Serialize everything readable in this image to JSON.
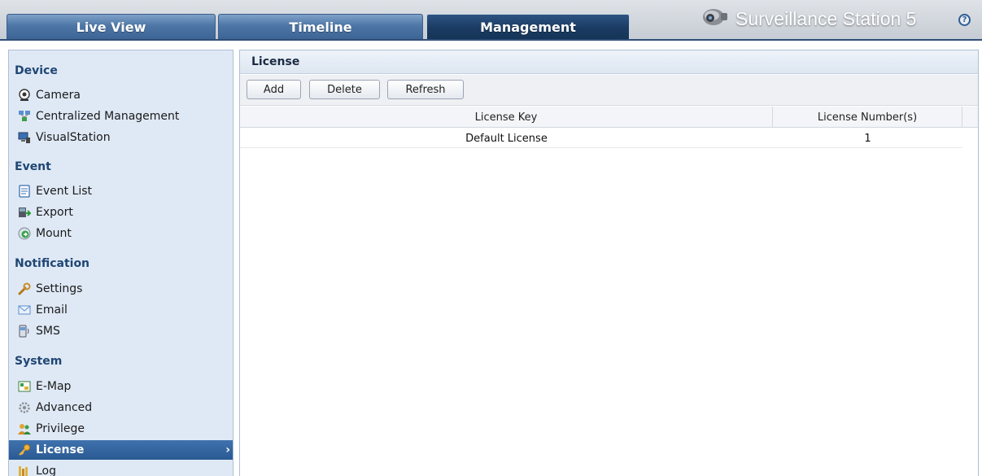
{
  "tabs": [
    {
      "label": "Live View",
      "active": false
    },
    {
      "label": "Timeline",
      "active": false
    },
    {
      "label": "Management",
      "active": true
    }
  ],
  "brand": {
    "title": "Surveillance Station 5",
    "icon": "camera-logo-icon",
    "help_icon": "help-icon",
    "help_glyph": "?"
  },
  "sidebar": {
    "groups": [
      {
        "title": "Device",
        "items": [
          {
            "label": "Camera",
            "icon": "camera-icon"
          },
          {
            "label": "Centralized Management",
            "icon": "centralized-management-icon"
          },
          {
            "label": "VisualStation",
            "icon": "visualstation-icon"
          }
        ]
      },
      {
        "title": "Event",
        "items": [
          {
            "label": "Event List",
            "icon": "event-list-icon"
          },
          {
            "label": "Export",
            "icon": "export-icon"
          },
          {
            "label": "Mount",
            "icon": "mount-icon"
          }
        ]
      },
      {
        "title": "Notification",
        "items": [
          {
            "label": "Settings",
            "icon": "wrench-icon"
          },
          {
            "label": "Email",
            "icon": "email-icon"
          },
          {
            "label": "SMS",
            "icon": "sms-icon"
          }
        ]
      },
      {
        "title": "System",
        "items": [
          {
            "label": "E-Map",
            "icon": "emap-icon"
          },
          {
            "label": "Advanced",
            "icon": "gear-icon"
          },
          {
            "label": "Privilege",
            "icon": "users-icon"
          },
          {
            "label": "License",
            "icon": "key-icon",
            "selected": true
          },
          {
            "label": "Log",
            "icon": "log-icon"
          }
        ]
      }
    ],
    "chevron": "›"
  },
  "main": {
    "title": "License",
    "toolbar": {
      "add": "Add",
      "delete": "Delete",
      "refresh": "Refresh"
    },
    "columns": [
      "License Key",
      "License Number(s)"
    ],
    "rows": [
      {
        "key": "Default License",
        "number": "1"
      }
    ]
  },
  "colors": {
    "accent": "#2a5a93",
    "sidebar_bg": "#dfe9f5",
    "topbar_line": "#2f4f78"
  }
}
